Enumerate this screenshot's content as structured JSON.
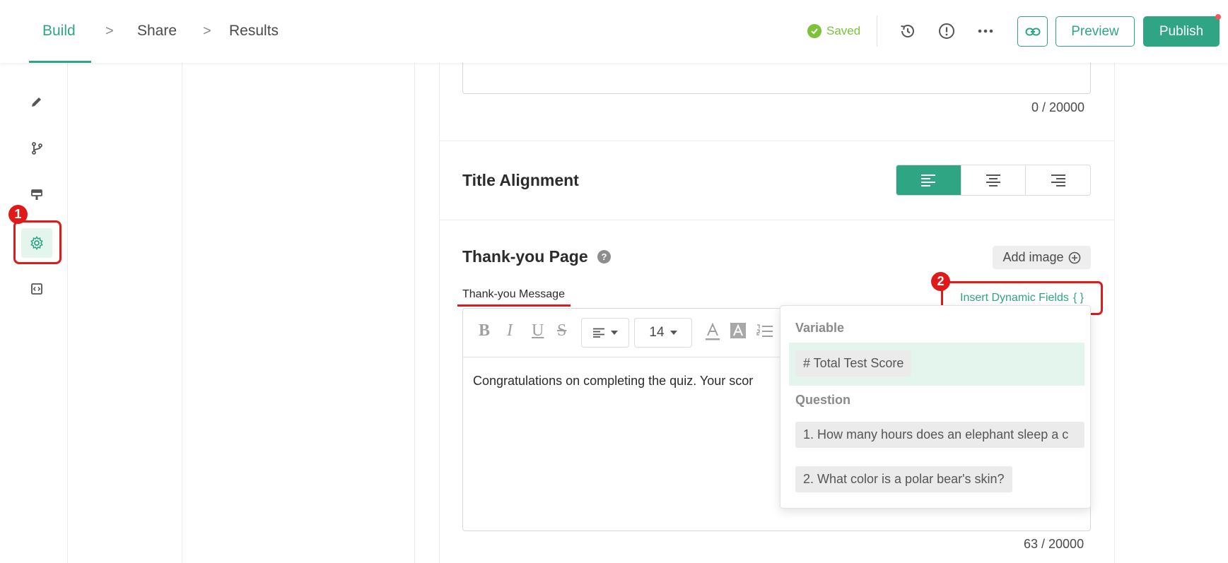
{
  "nav": {
    "steps": [
      "Build",
      "Share",
      "Results"
    ],
    "separator": ">"
  },
  "header": {
    "saved_label": "Saved",
    "preview_label": "Preview",
    "publish_label": "Publish",
    "icons": [
      "history-icon",
      "alert-icon",
      "more-icon",
      "link-icon"
    ]
  },
  "annotations": {
    "badge_1": "1",
    "badge_2": "2"
  },
  "colors": {
    "accent": "#2fa583",
    "saved": "#7cc23a",
    "annotation": "#e0191a"
  },
  "rail": {
    "icons": [
      "pencil-icon",
      "branch-icon",
      "paint-icon",
      "settings-icon",
      "code-icon"
    ],
    "active": "settings-icon"
  },
  "previous_field": {
    "counter": "0 / 20000"
  },
  "title_alignment": {
    "label": "Title Alignment",
    "options": [
      "align-left",
      "align-center",
      "align-right"
    ],
    "selected": "align-left"
  },
  "thank_you": {
    "title": "Thank-you Page",
    "help": "?",
    "add_image_label": "Add image",
    "message_label": "Thank-you Message",
    "insert_fields_label": "Insert Dynamic Fields",
    "insert_fields_glyph": "{ }",
    "counter": "63 / 20000"
  },
  "editor": {
    "bold": "B",
    "italic": "I",
    "underline": "U",
    "strike": "S",
    "font_size": "14",
    "text": "Congratulations on completing the quiz. Your scor"
  },
  "dropdown": {
    "variable_header": "Variable",
    "variable_item": "# Total Test Score",
    "question_header": "Question",
    "questions": [
      "1. How many hours does an elephant sleep a c",
      "2. What color is a polar bear's skin?"
    ]
  }
}
